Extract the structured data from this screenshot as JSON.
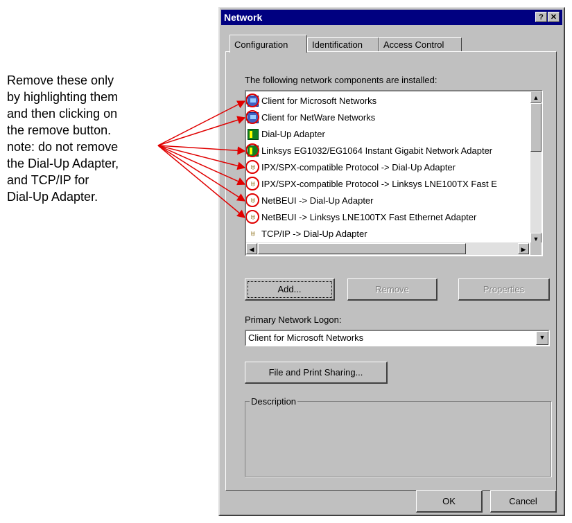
{
  "annotation": {
    "text": "Remove these only\nby highlighting them\nand then clicking on\nthe remove button.\nnote: do not remove\nthe Dial-Up Adapter,\nand TCP/IP for\nDial-Up Adapter."
  },
  "window": {
    "title": "Network",
    "help_label": "?",
    "close_label": "✕"
  },
  "tabs": [
    {
      "label": "Configuration"
    },
    {
      "label": "Identification"
    },
    {
      "label": "Access Control"
    }
  ],
  "components": {
    "label": "The following network components are installed:",
    "items": [
      {
        "label": "Client for Microsoft Networks",
        "icon": "network-client-icon",
        "circled": true
      },
      {
        "label": "Client for NetWare Networks",
        "icon": "network-client-icon",
        "circled": true
      },
      {
        "label": "Dial-Up Adapter",
        "icon": "network-adapter-icon",
        "circled": false
      },
      {
        "label": "Linksys EG1032/EG1064 Instant Gigabit Network Adapter",
        "icon": "network-adapter-icon",
        "circled": true
      },
      {
        "label": "IPX/SPX-compatible Protocol -> Dial-Up Adapter",
        "icon": "protocol-icon",
        "circled": true
      },
      {
        "label": "IPX/SPX-compatible Protocol -> Linksys LNE100TX Fast E",
        "icon": "protocol-icon",
        "circled": true
      },
      {
        "label": "NetBEUI -> Dial-Up Adapter",
        "icon": "protocol-icon",
        "circled": true
      },
      {
        "label": "NetBEUI -> Linksys LNE100TX Fast Ethernet Adapter",
        "icon": "protocol-icon",
        "circled": true
      },
      {
        "label": "TCP/IP -> Dial-Up Adapter",
        "icon": "protocol-icon",
        "circled": false
      }
    ]
  },
  "buttons": {
    "add": "Add...",
    "remove": "Remove",
    "properties": "Properties",
    "file_print": "File and Print Sharing...",
    "ok": "OK",
    "cancel": "Cancel"
  },
  "logon": {
    "label": "Primary Network Logon:",
    "value": "Client for Microsoft Networks"
  },
  "description": {
    "label": "Description"
  },
  "colors": {
    "titlebar": "#000080",
    "annotation_red": "#e00000",
    "face": "#c0c0c0"
  }
}
